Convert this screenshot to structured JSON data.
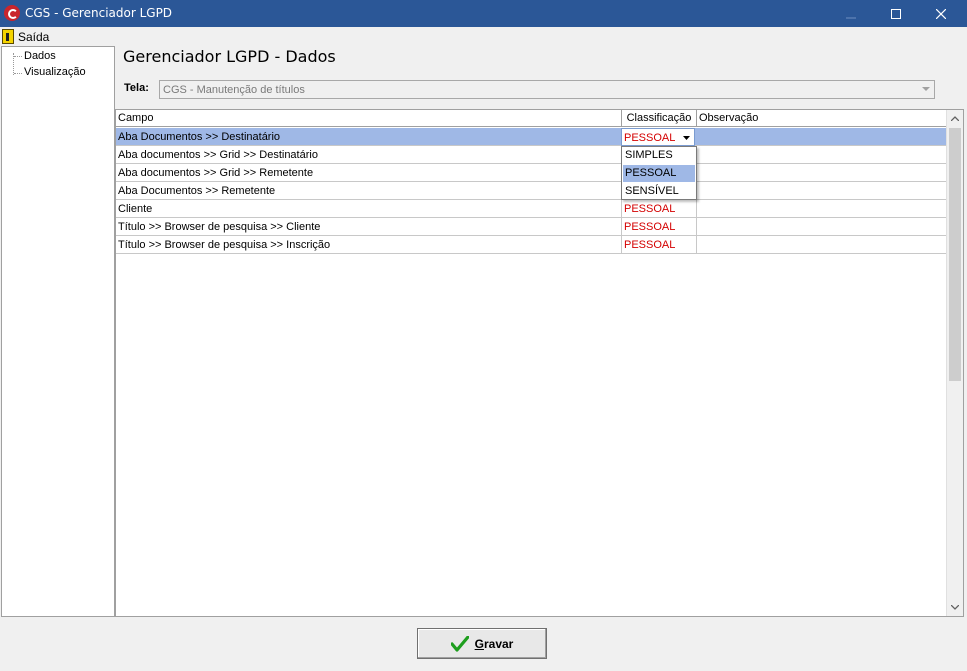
{
  "window": {
    "title": "CGS - Gerenciador LGPD"
  },
  "menu": {
    "exit_label": "Saída"
  },
  "tree": {
    "items": [
      "Dados",
      "Visualização"
    ]
  },
  "main": {
    "heading": "Gerenciador LGPD - Dados",
    "tela_label": "Tela:",
    "tela_value": "CGS - Manutenção de títulos"
  },
  "grid": {
    "columns": [
      "Campo",
      "Classificação",
      "Observação"
    ],
    "rows": [
      {
        "campo": "Aba Documentos >> Destinatário",
        "classificacao": "PESSOAL",
        "observacao": ""
      },
      {
        "campo": "Aba documentos >> Grid  >> Destinatário",
        "classificacao": "",
        "observacao": ""
      },
      {
        "campo": "Aba documentos >> Grid  >> Remetente",
        "classificacao": "",
        "observacao": ""
      },
      {
        "campo": "Aba Documentos >> Remetente",
        "classificacao": "",
        "observacao": ""
      },
      {
        "campo": "Cliente",
        "classificacao": "PESSOAL",
        "observacao": ""
      },
      {
        "campo": "Título >> Browser de pesquisa >> Cliente",
        "classificacao": "PESSOAL",
        "observacao": ""
      },
      {
        "campo": "Título >> Browser de pesquisa >> Inscrição",
        "classificacao": "PESSOAL",
        "observacao": ""
      }
    ],
    "dropdown_options": [
      "SIMPLES",
      "PESSOAL",
      "SENSÍVEL"
    ],
    "dropdown_selected": "PESSOAL"
  },
  "footer": {
    "save_label_first": "G",
    "save_label_rest": "ravar"
  },
  "colors": {
    "titlebar": "#2b5797",
    "selection": "#9fb8e6",
    "classification_text": "#d40000",
    "save_check": "#1e9e1e"
  }
}
